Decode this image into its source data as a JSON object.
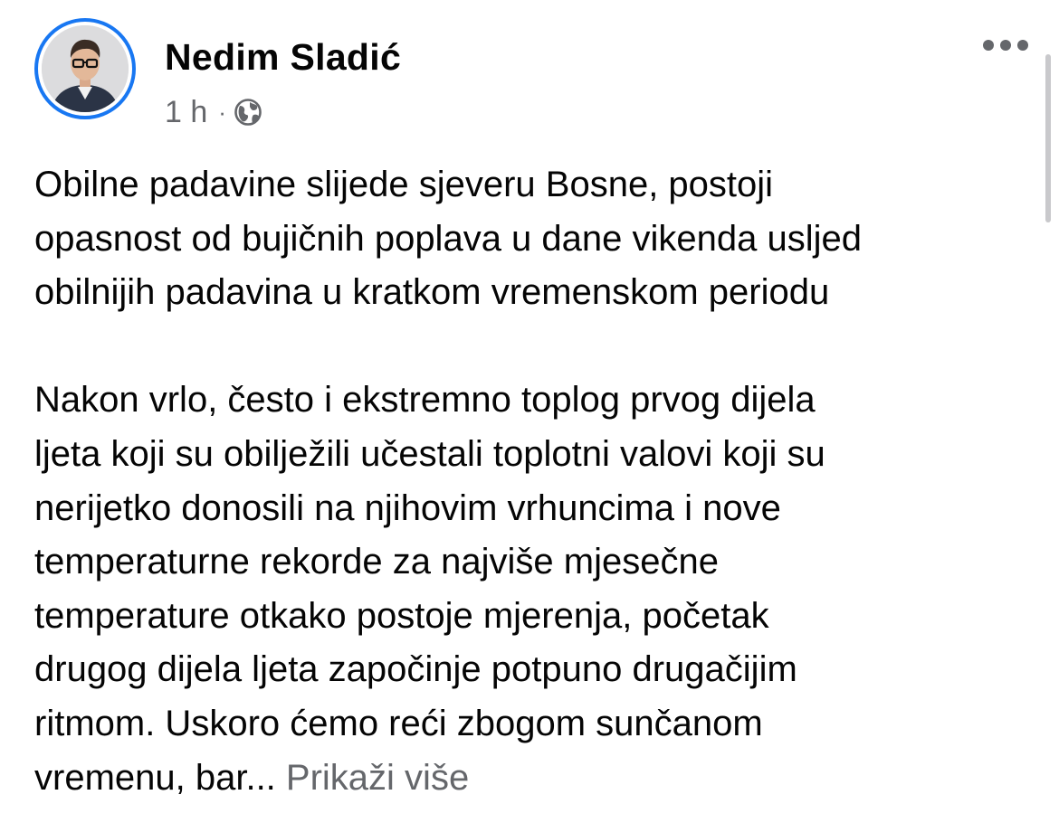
{
  "post": {
    "author": "Nedim Sladić",
    "timestamp": "1 h",
    "separator": "·",
    "privacy_icon": "globe-icon",
    "more_icon": "more-options-icon",
    "paragraph1": [
      "Obilne padavine slijede sjeveru Bosne, postoji",
      "opasnost od bujičnih poplava u dane vikenda usljed",
      "obilnijih padavina u kratkom vremenskom periodu"
    ],
    "paragraph2": [
      "Nakon vrlo, često i ekstremno toplog prvog dijela",
      "ljeta koji su obilježili učestali toplotni valovi koji su",
      "nerijetko donosili na njihovim vrhuncima i nove",
      "temperaturne rekorde za najviše mjesečne",
      "temperature otkako postoje mjerenja, početak",
      "drugog dijela ljeta započinje potpuno drugačijim",
      "ritmom. Uskoro ćemo reći zbogom sunčanom"
    ],
    "last_line_text": "vremenu, bar...",
    "see_more": "Prikaži više"
  },
  "colors": {
    "accent": "#1877f2",
    "secondary_text": "#65676b",
    "primary_text": "#050505"
  }
}
